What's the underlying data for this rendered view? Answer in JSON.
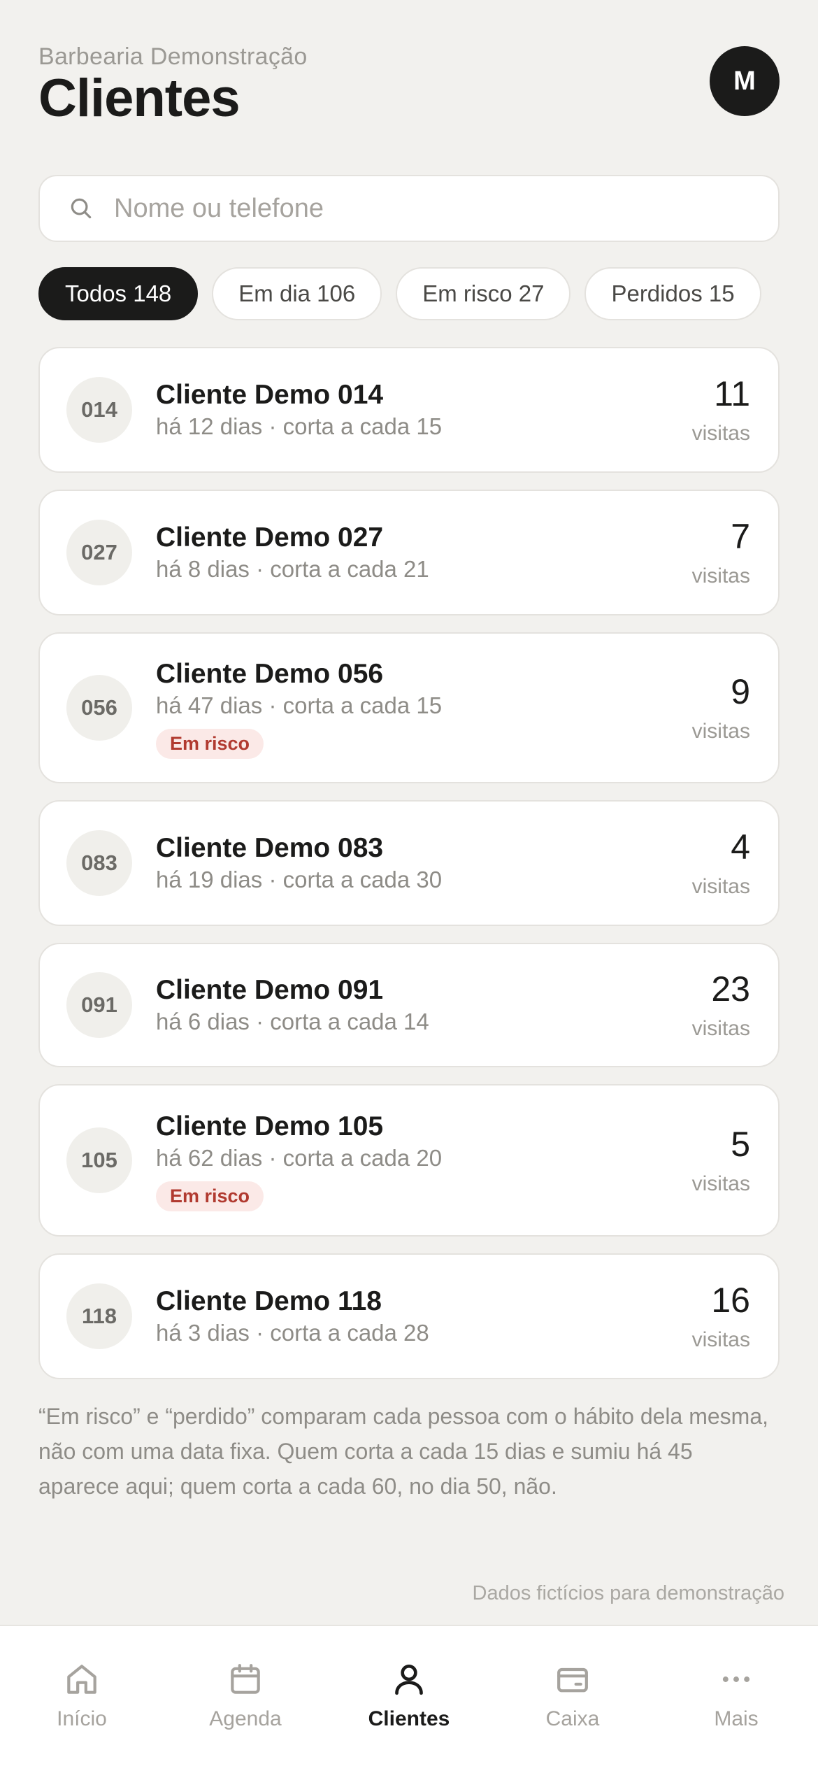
{
  "header": {
    "business_name": "Barbearia Demonstração",
    "title": "Clientes",
    "avatar_initial": "M"
  },
  "search": {
    "placeholder": "Nome ou telefone",
    "value": ""
  },
  "filters": [
    {
      "label": "Todos 148",
      "active": true
    },
    {
      "label": "Em dia 106",
      "active": false
    },
    {
      "label": "Em risco 27",
      "active": false
    },
    {
      "label": "Perdidos 15",
      "active": false
    }
  ],
  "clients": [
    {
      "num": "014",
      "name": "Cliente Demo 014",
      "meta": "há 12 dias · corta a cada 15",
      "visits": "11",
      "visits_label": "visitas",
      "badge": ""
    },
    {
      "num": "027",
      "name": "Cliente Demo 027",
      "meta": "há 8 dias · corta a cada 21",
      "visits": "7",
      "visits_label": "visitas",
      "badge": ""
    },
    {
      "num": "056",
      "name": "Cliente Demo 056",
      "meta": "há 47 dias · corta a cada 15",
      "visits": "9",
      "visits_label": "visitas",
      "badge": "Em risco"
    },
    {
      "num": "083",
      "name": "Cliente Demo 083",
      "meta": "há 19 dias · corta a cada 30",
      "visits": "4",
      "visits_label": "visitas",
      "badge": ""
    },
    {
      "num": "091",
      "name": "Cliente Demo 091",
      "meta": "há 6 dias · corta a cada 14",
      "visits": "23",
      "visits_label": "visitas",
      "badge": ""
    },
    {
      "num": "105",
      "name": "Cliente Demo 105",
      "meta": "há 62 dias · corta a cada 20",
      "visits": "5",
      "visits_label": "visitas",
      "badge": "Em risco"
    },
    {
      "num": "118",
      "name": "Cliente Demo 118",
      "meta": "há 3 dias · corta a cada 28",
      "visits": "16",
      "visits_label": "visitas",
      "badge": ""
    }
  ],
  "note": "“Em risco” e “perdido” comparam cada pessoa com o hábito dela mesma, não com uma data fixa. Quem corta a cada 15 dias e sumiu há 45 aparece aqui; quem corta a cada 60, no dia 50, não.",
  "disclaimer": "Dados fictícios para demonstração",
  "tabbar": [
    {
      "label": "Início",
      "icon": "home-icon",
      "active": false
    },
    {
      "label": "Agenda",
      "icon": "calendar-icon",
      "active": false
    },
    {
      "label": "Clientes",
      "icon": "user-icon",
      "active": true
    },
    {
      "label": "Caixa",
      "icon": "wallet-icon",
      "active": false
    },
    {
      "label": "Mais",
      "icon": "more-icon",
      "active": false
    }
  ],
  "colors": {
    "background": "#f2f1ee",
    "primary": "#1b1b1a",
    "risk_badge_bg": "#fbe9e7",
    "risk_badge_text": "#b13a30"
  }
}
